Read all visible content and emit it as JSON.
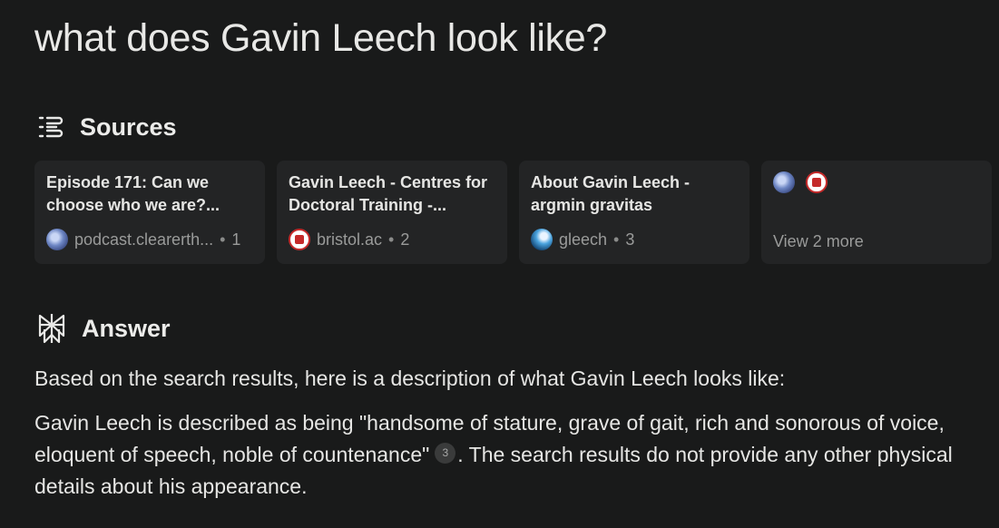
{
  "query": "what does Gavin Leech look like?",
  "sources": {
    "heading": "Sources",
    "cards": [
      {
        "title": "Episode 171: Can we choose who we are?...",
        "domain": "podcast.clearerth...",
        "index": "1",
        "favicon": "globe-icon"
      },
      {
        "title": "Gavin Leech - Centres for Doctoral Training -...",
        "domain": "bristol.ac",
        "index": "2",
        "favicon": "bristol-icon"
      },
      {
        "title": "About Gavin Leech - argmin gravitas",
        "domain": "gleech",
        "index": "3",
        "favicon": "gleech-icon"
      }
    ],
    "more": {
      "label": "View 2 more",
      "favicons": [
        "globe-icon",
        "bristol-icon"
      ]
    }
  },
  "answer": {
    "heading": "Answer",
    "paragraph1": "Based on the search results, here is a description of what Gavin Leech looks like:",
    "paragraph2_before": "Gavin Leech is described as being \"handsome of stature, grave of gait, rich and sonorous of voice, eloquent of speech, noble of countenance\"",
    "citation": "3",
    "paragraph2_after": ". The search results do not provide any other physical details about his appearance."
  },
  "colors": {
    "background": "#191a1a",
    "card": "#232425",
    "text": "#e8e8e6",
    "muted": "#9a9b9a"
  }
}
